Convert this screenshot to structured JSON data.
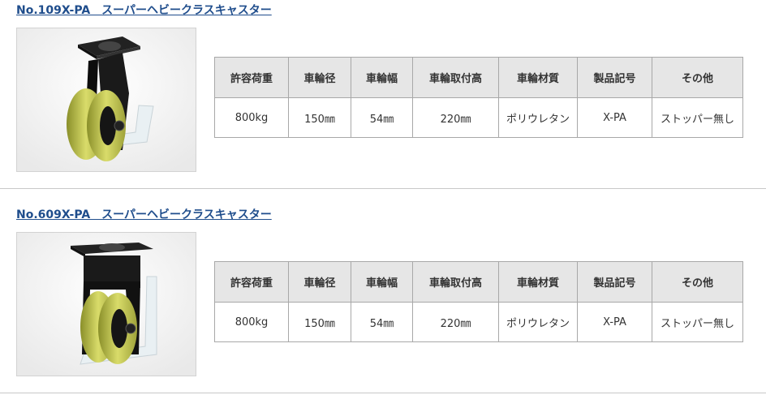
{
  "products": [
    {
      "title": "No.109X-PA　スーパーヘビークラスキャスター",
      "table": {
        "headers": [
          "許容荷重",
          "車輪径",
          "車輪幅",
          "車輪取付高",
          "車輪材質",
          "製品記号",
          "その他"
        ],
        "values": [
          "800kg",
          "150㎜",
          "54㎜",
          "220㎜",
          "ポリウレタン",
          "X-PA",
          "ストッパー無し"
        ]
      }
    },
    {
      "title": "No.609X-PA　スーパーヘビークラスキャスター",
      "table": {
        "headers": [
          "許容荷重",
          "車輪径",
          "車輪幅",
          "車輪取付高",
          "車輪材質",
          "製品記号",
          "その他"
        ],
        "values": [
          "800kg",
          "150㎜",
          "54㎜",
          "220㎜",
          "ポリウレタン",
          "X-PA",
          "ストッパー無し"
        ]
      }
    }
  ]
}
